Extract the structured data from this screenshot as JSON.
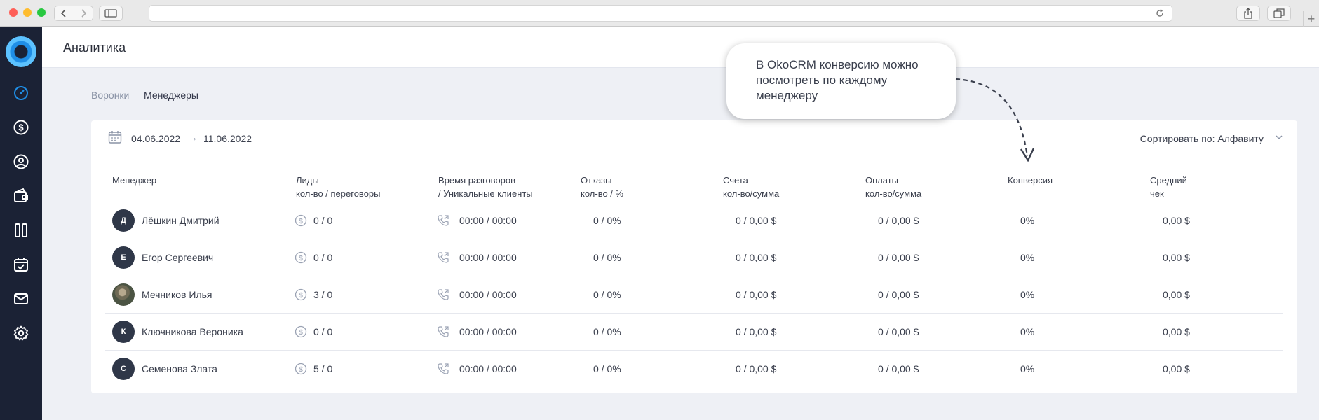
{
  "header": {
    "title": "Аналитика"
  },
  "tabs": [
    {
      "label": "Воронки",
      "active": false
    },
    {
      "label": "Менеджеры",
      "active": true
    }
  ],
  "filter": {
    "date_from": "04.06.2022",
    "arrow": "→",
    "date_to": "11.06.2022",
    "sort_label": "Сортировать по: Алфавиту"
  },
  "table": {
    "headers": [
      {
        "line1": "Менеджер",
        "line2": ""
      },
      {
        "line1": "Лиды",
        "line2": "кол-во / переговоры"
      },
      {
        "line1": "Время разговоров",
        "line2": "/ Уникальные клиенты"
      },
      {
        "line1": "Отказы",
        "line2": "кол-во / %"
      },
      {
        "line1": "Счета",
        "line2": "кол-во/сумма"
      },
      {
        "line1": "Оплаты",
        "line2": "кол-во/сумма"
      },
      {
        "line1": "Конверсия",
        "line2": ""
      },
      {
        "line1": "Средний",
        "line2": "чек"
      }
    ],
    "rows": [
      {
        "initial": "Д",
        "name": "Лёшкин Дмитрий",
        "leads": "0 / 0",
        "calls": "00:00 / 00:00",
        "refusals": "0 / 0%",
        "invoices": "0 / 0,00 $",
        "payments": "0 / 0,00 $",
        "conversion": "0%",
        "avg_check": "0,00 $"
      },
      {
        "initial": "Е",
        "name": "Егор Сергеевич",
        "leads": "0 / 0",
        "calls": "00:00 / 00:00",
        "refusals": "0 / 0%",
        "invoices": "0 / 0,00 $",
        "payments": "0 / 0,00 $",
        "conversion": "0%",
        "avg_check": "0,00 $"
      },
      {
        "initial": "",
        "name": "Мечников Илья",
        "leads": "3 / 0",
        "calls": "00:00 / 00:00",
        "refusals": "0 / 0%",
        "invoices": "0 / 0,00 $",
        "payments": "0 / 0,00 $",
        "conversion": "0%",
        "avg_check": "0,00 $"
      },
      {
        "initial": "К",
        "name": "Ключникова Вероника",
        "leads": "0 / 0",
        "calls": "00:00 / 00:00",
        "refusals": "0 / 0%",
        "invoices": "0 / 0,00 $",
        "payments": "0 / 0,00 $",
        "conversion": "0%",
        "avg_check": "0,00 $"
      },
      {
        "initial": "С",
        "name": "Семенова Злата",
        "leads": "5 / 0",
        "calls": "00:00 / 00:00",
        "refusals": "0 / 0%",
        "invoices": "0 / 0,00 $",
        "payments": "0 / 0,00 $",
        "conversion": "0%",
        "avg_check": "0,00 $"
      }
    ]
  },
  "callout": {
    "text": "В OkoCRM конверсию можно посмотреть по каждому менеджеру"
  },
  "sidebar": {
    "icons": [
      "dashboard-icon",
      "dollar-icon",
      "user-icon",
      "wallet-icon",
      "kanban-icon",
      "calendar-icon",
      "mail-icon",
      "settings-icon"
    ],
    "active_color": "#1f8ee6"
  },
  "colors": {
    "sidebar_bg": "#1b2235",
    "page_bg": "#eef0f5",
    "accent": "#1f8ee6"
  }
}
